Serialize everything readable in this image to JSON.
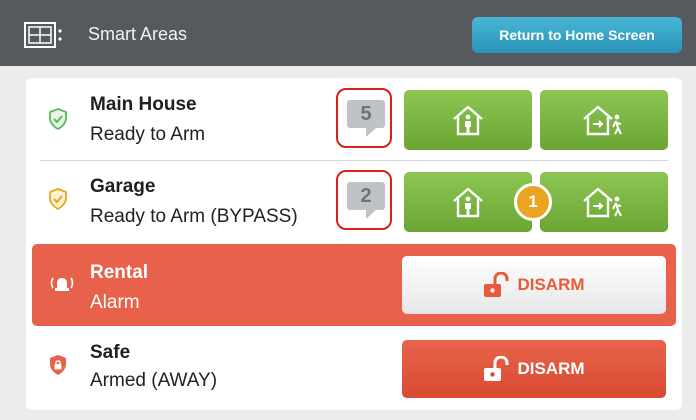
{
  "header": {
    "title": "Smart Areas",
    "icon": "floorplan-icon",
    "home_button_label": "Return to Home Screen"
  },
  "areas": [
    {
      "name": "Main House",
      "status": "Ready to Arm",
      "status_icon": "shield-check-icon",
      "icon_color": "#5cb85c",
      "count": "5",
      "buttons": [
        "arm-stay-icon",
        "arm-away-icon"
      ]
    },
    {
      "name": "Garage",
      "status": "Ready to Arm (BYPASS)",
      "status_icon": "shield-check-icon",
      "icon_color": "#e9a520",
      "count": "2",
      "badge": "1",
      "buttons": [
        "arm-stay-icon",
        "arm-away-icon"
      ]
    },
    {
      "name": "Rental",
      "status": "Alarm",
      "status_icon": "siren-icon",
      "disarm_label": "DISARM"
    },
    {
      "name": "Safe",
      "status": "Armed (AWAY)",
      "status_icon": "shield-lock-icon",
      "icon_color": "#e8614a",
      "disarm_label": "DISARM"
    }
  ],
  "colors": {
    "header": "#56595d",
    "arm_green": "#7bb844",
    "alarm_red": "#e8614a",
    "home_button": "#3aa5c9",
    "badge": "#e9a520",
    "highlight": "#d8201c"
  }
}
